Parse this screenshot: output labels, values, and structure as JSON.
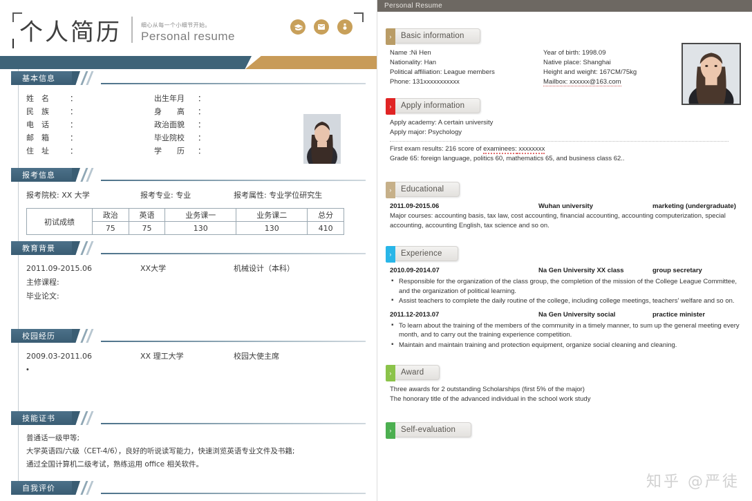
{
  "left": {
    "title_cn": "个人简历",
    "subtitle_cn": "细心从每一个小细节开始。",
    "subtitle_en": "Personal resume",
    "icons": [
      "graduation-cap-icon",
      "mail-icon",
      "medal-icon"
    ],
    "sections": {
      "basic": {
        "tab": "基本信息",
        "left_fields": [
          {
            "key": "姓　名",
            "colon": "：",
            "value": ""
          },
          {
            "key": "民　族",
            "colon": "：",
            "value": ""
          },
          {
            "key": "电　话",
            "colon": "：",
            "value": ""
          },
          {
            "key": "邮　箱",
            "colon": "：",
            "value": ""
          },
          {
            "key": "住　址",
            "colon": "：",
            "value": ""
          }
        ],
        "right_fields": [
          {
            "key": "出生年月",
            "colon": "：",
            "value": ""
          },
          {
            "key": "身　　高",
            "colon": "：",
            "value": ""
          },
          {
            "key": "政治面貌",
            "colon": "：",
            "value": ""
          },
          {
            "key": "毕业院校",
            "colon": "：",
            "value": ""
          },
          {
            "key": "学　　历",
            "colon": "：",
            "value": ""
          }
        ]
      },
      "apply": {
        "tab": "报考信息",
        "school_label": "报考院校:",
        "school_value": "XX 大学",
        "major_label": "报考专业:",
        "major_value": "专业",
        "type_label": "报考属性:",
        "type_value": "专业学位研究生",
        "table": {
          "row_label": "初试成绩",
          "headers": [
            "政治",
            "英语",
            "业务课一",
            "业务课二",
            "总分"
          ],
          "values": [
            "75",
            "75",
            "130",
            "130",
            "410"
          ]
        }
      },
      "education": {
        "tab": "教育背景",
        "date": "2011.09-2015.06",
        "school": "XX大学",
        "major": "机械设计（本科）",
        "courses_label": "主修课程:",
        "thesis_label": "毕业论文:"
      },
      "campus": {
        "tab": "校园经历",
        "date": "2009.03-2011.06",
        "school": "XX 理工大学",
        "role": "校园大使主席",
        "bullet": "•"
      },
      "skills": {
        "tab": "技能证书",
        "lines": [
          "普通话一级甲等;",
          "大学英语四/六级（CET-4/6），良好的听说读写能力，快速浏览英语专业文件及书籍;",
          "通过全国计算机二级考试，熟练运用 office 相关软件。"
        ]
      },
      "self": {
        "tab": "自我评价"
      }
    }
  },
  "right": {
    "window_title": "Personal Resume",
    "sections": [
      {
        "name": "basic-information",
        "label": "Basic information",
        "accent": "#b99c66",
        "arrow": "›"
      },
      {
        "name": "apply-information",
        "label": "Apply information",
        "accent": "#e02424",
        "arrow": "›"
      },
      {
        "name": "educational",
        "label": "Educational",
        "accent": "#c6b089",
        "arrow": "›"
      },
      {
        "name": "experience",
        "label": "Experience",
        "accent": "#29b6e8",
        "arrow": "›"
      },
      {
        "name": "award",
        "label": "Award",
        "accent": "#8bc34a",
        "arrow": "›"
      },
      {
        "name": "self-evaluation",
        "label": "Self-evaluation",
        "accent": "#4caf50",
        "arrow": "›"
      }
    ],
    "basic": {
      "left": [
        "Name :Ni Hen",
        "Nationality: Han",
        "Political affiliation: League members",
        "Phone: 131xxxxxxxxxxx"
      ],
      "right": [
        "Year of birth: 1998.09",
        "Native place: Shanghai",
        "Height and weight: 167CM/75kg",
        "Mailbox: xxxxxx@163.com"
      ]
    },
    "apply": {
      "academy": "Apply academy: A certain university",
      "major": "Apply major: Psychology",
      "exam_prefix": "First exam results: 216 score of ",
      "exam_marked": "examinees:",
      "exam_tail": " xxxxxxxx",
      "grade": "Grade 65: foreign language, politics 60, mathematics 65, and business class 62.."
    },
    "educational": {
      "date": "2011.09-2015.06",
      "school": "Wuhan university",
      "major": "marketing (undergraduate)",
      "courses": "Major courses: accounting basis, tax law, cost accounting, financial accounting, accounting computerization, special accounting, accounting English, tax science and so on."
    },
    "experience": [
      {
        "date": "2010.09-2014.07",
        "org": "Na Gen University XX class",
        "role": "group secretary",
        "bullets": [
          "Responsible for the organization of the class group, the completion of the mission of the College League Committee, and the organization of political learning.",
          "Assist teachers to complete the daily routine of the college, including college meetings, teachers' welfare and so on."
        ]
      },
      {
        "date": "2011.12-2013.07",
        "org": "Na Gen University social",
        "role": "practice minister",
        "bullets": [
          "To learn about the training of the members of the community in a timely manner, to sum up the general meeting every month, and to carry out the training experience competition.",
          "Maintain and maintain training and protection equipment, organize social cleaning and cleaning."
        ]
      }
    ],
    "award": {
      "lines": [
        "Three awards for 2 outstanding Scholarships (first 5% of the major)",
        "The honorary title of the advanced individual in the school work study"
      ]
    },
    "watermark": "知乎 @严徒"
  }
}
